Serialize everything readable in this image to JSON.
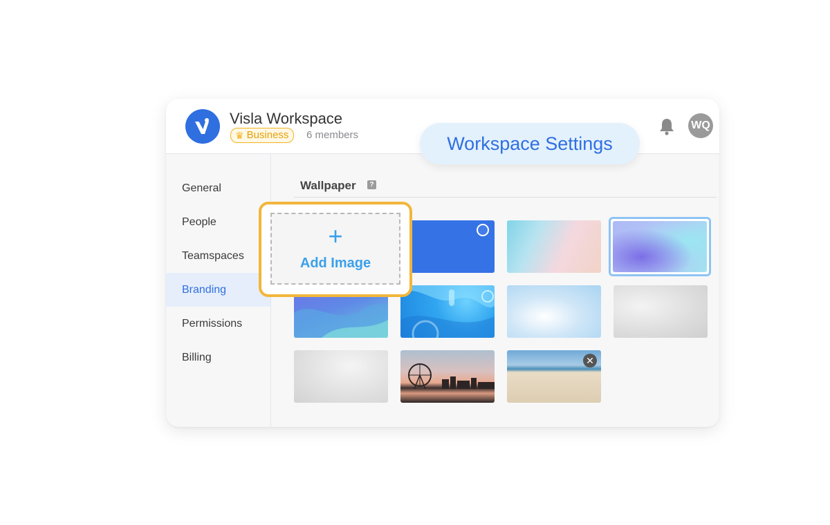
{
  "header": {
    "workspace_name": "Visla Workspace",
    "plan_label": "Business",
    "members_label": "6 members",
    "avatar_initials": "WQ",
    "logo_icon": "visla-logo-icon",
    "notification_icon": "bell-icon"
  },
  "sidebar": {
    "items": [
      {
        "label": "General",
        "active": false
      },
      {
        "label": "People",
        "active": false
      },
      {
        "label": "Teamspaces",
        "active": false
      },
      {
        "label": "Branding",
        "active": true
      },
      {
        "label": "Permissions",
        "active": false
      },
      {
        "label": "Billing",
        "active": false
      }
    ]
  },
  "main": {
    "section_title": "Wallpaper",
    "help_icon": "question-icon",
    "add_image": {
      "plus": "+",
      "label": "Add Image"
    },
    "wallpapers": [
      {
        "name": "solid-blue",
        "selected": false
      },
      {
        "name": "pastel-gradient",
        "selected": false
      },
      {
        "name": "purple-aqua-gradient",
        "selected": true
      },
      {
        "name": "blue-waves",
        "selected": false
      },
      {
        "name": "abstract-blue",
        "selected": false
      },
      {
        "name": "sky-clouds",
        "selected": false
      },
      {
        "name": "grey-marble",
        "selected": false
      },
      {
        "name": "white-marble",
        "selected": false
      },
      {
        "name": "ferris-wheel-sunset",
        "selected": false
      },
      {
        "name": "sandy-beach",
        "selected": false
      }
    ]
  },
  "overlay": {
    "title": "Workspace Settings"
  },
  "colors": {
    "accent": "#2f6fe0",
    "highlight": "#f2b63a",
    "add_text": "#3aa0ea"
  }
}
